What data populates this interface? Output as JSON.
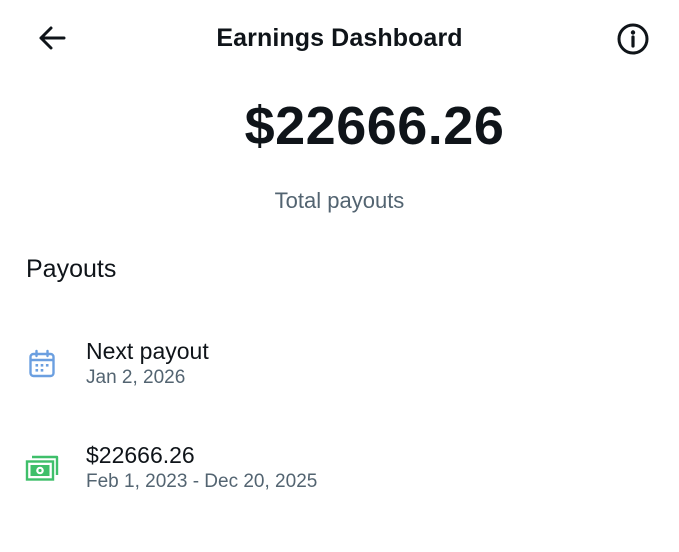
{
  "header": {
    "title": "Earnings Dashboard",
    "back_icon": "arrow-left-icon",
    "info_icon": "info-circle-icon"
  },
  "summary": {
    "total_amount": "$22666.26",
    "total_label": "Total payouts"
  },
  "payouts": {
    "section_title": "Payouts",
    "items": [
      {
        "icon": "calendar-icon",
        "icon_color": "#6b9fe0",
        "title": "Next payout",
        "subtitle": "Jan 2, 2026"
      },
      {
        "icon": "cash-icon",
        "icon_color": "#3fbf6a",
        "title": "$22666.26",
        "subtitle": "Feb 1, 2023 - Dec 20, 2025"
      }
    ]
  },
  "colors": {
    "text_primary": "#0f1419",
    "text_secondary": "#536471",
    "background": "#ffffff"
  }
}
